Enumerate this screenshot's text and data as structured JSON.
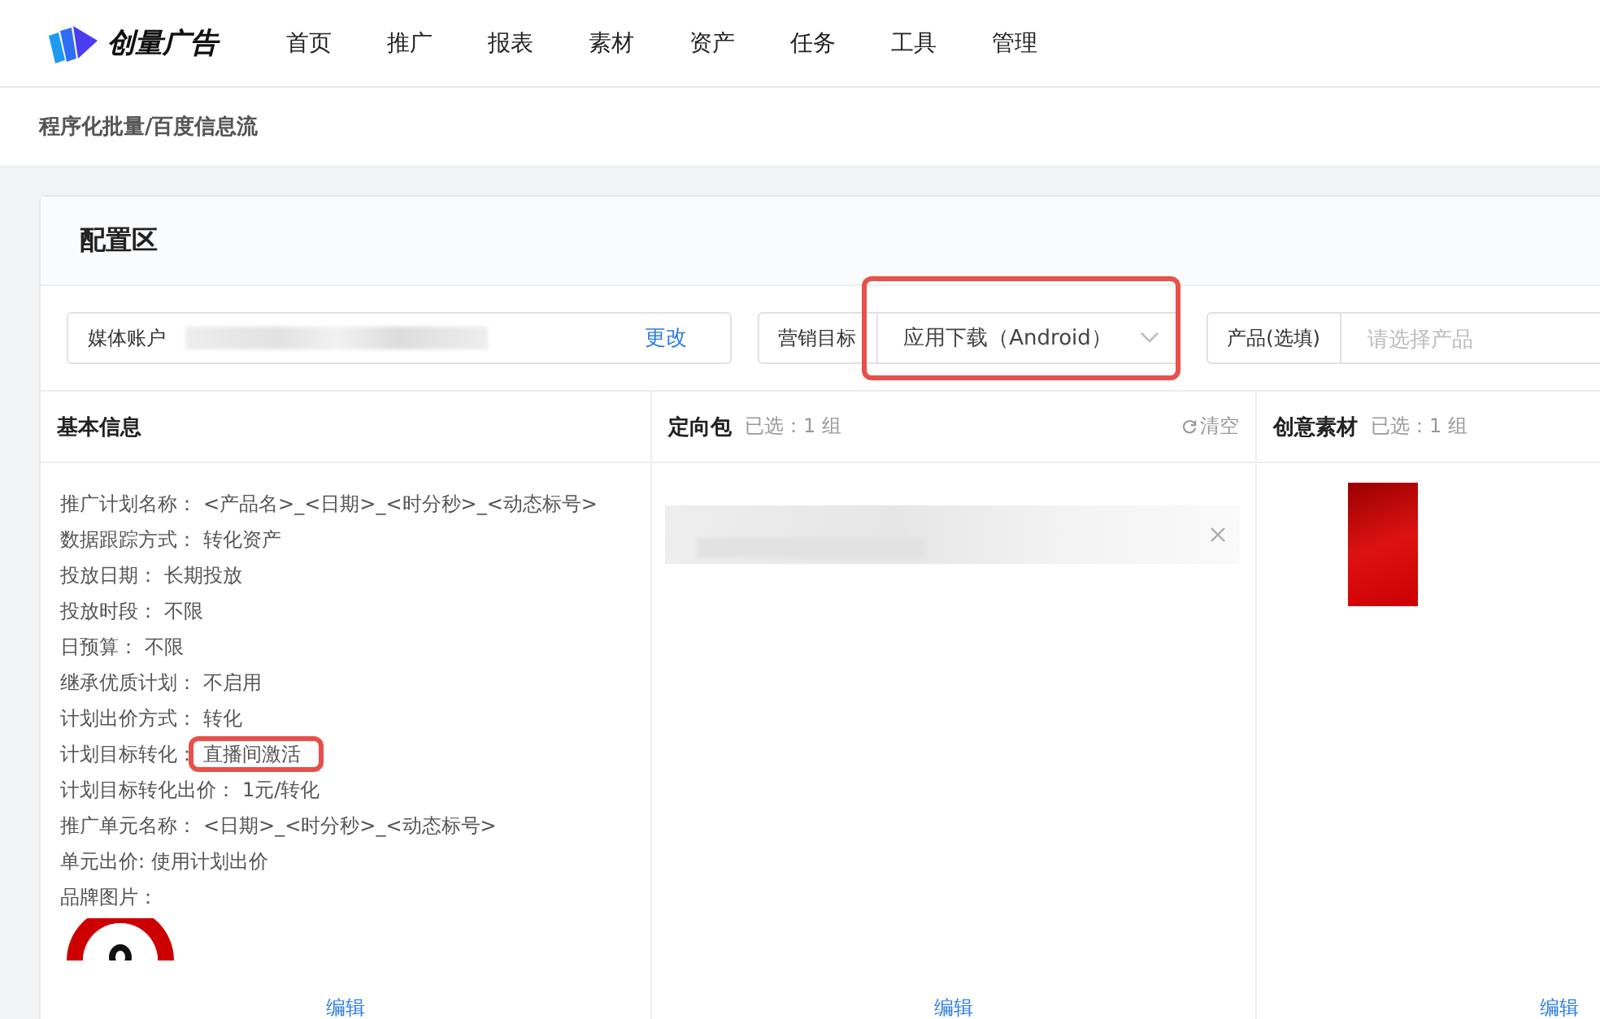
{
  "brand": {
    "name": "创量广告"
  },
  "nav": [
    {
      "label": "首页"
    },
    {
      "label": "推广"
    },
    {
      "label": "报表"
    },
    {
      "label": "素材"
    },
    {
      "label": "资产"
    },
    {
      "label": "任务"
    },
    {
      "label": "工具"
    },
    {
      "label": "管理"
    }
  ],
  "breadcrumb": "程序化批量/百度信息流",
  "config": {
    "title": "配置区",
    "media_account": {
      "label": "媒体账户",
      "action": "更改"
    },
    "marketing_goal": {
      "label": "营销目标",
      "value": "应用下载（Android）",
      "annotated": true
    },
    "product": {
      "label": "产品(选填)",
      "placeholder": "请选择产品"
    }
  },
  "basic_info": {
    "title": "基本信息",
    "rows": [
      {
        "label": "推广计划名称：",
        "value": "<产品名>_<日期>_<时分秒>_<动态标号>"
      },
      {
        "label": "数据跟踪方式：",
        "value": "转化资产"
      },
      {
        "label": "投放日期：",
        "value": "长期投放"
      },
      {
        "label": "投放时段：",
        "value": "不限"
      },
      {
        "label": "日预算：",
        "value": "不限"
      },
      {
        "label": "继承优质计划：",
        "value": "不启用"
      },
      {
        "label": "计划出价方式：",
        "value": "转化"
      },
      {
        "label": "计划目标转化：",
        "value": "直播间激活",
        "annotated": true
      },
      {
        "label": "计划目标转化出价：",
        "value": "1元/转化"
      },
      {
        "label": "推广单元名称：",
        "value": "<日期>_<时分秒>_<动态标号>"
      },
      {
        "label": "单元出价:",
        "value": "使用计划出价"
      },
      {
        "label": "品牌图片：",
        "value": ""
      }
    ],
    "edit": "编辑"
  },
  "targeting": {
    "title": "定向包",
    "count": "已选：1 组",
    "clear": "清空",
    "edit": "编辑"
  },
  "creative": {
    "title": "创意素材",
    "count": "已选：1 组",
    "edit": "编辑"
  }
}
